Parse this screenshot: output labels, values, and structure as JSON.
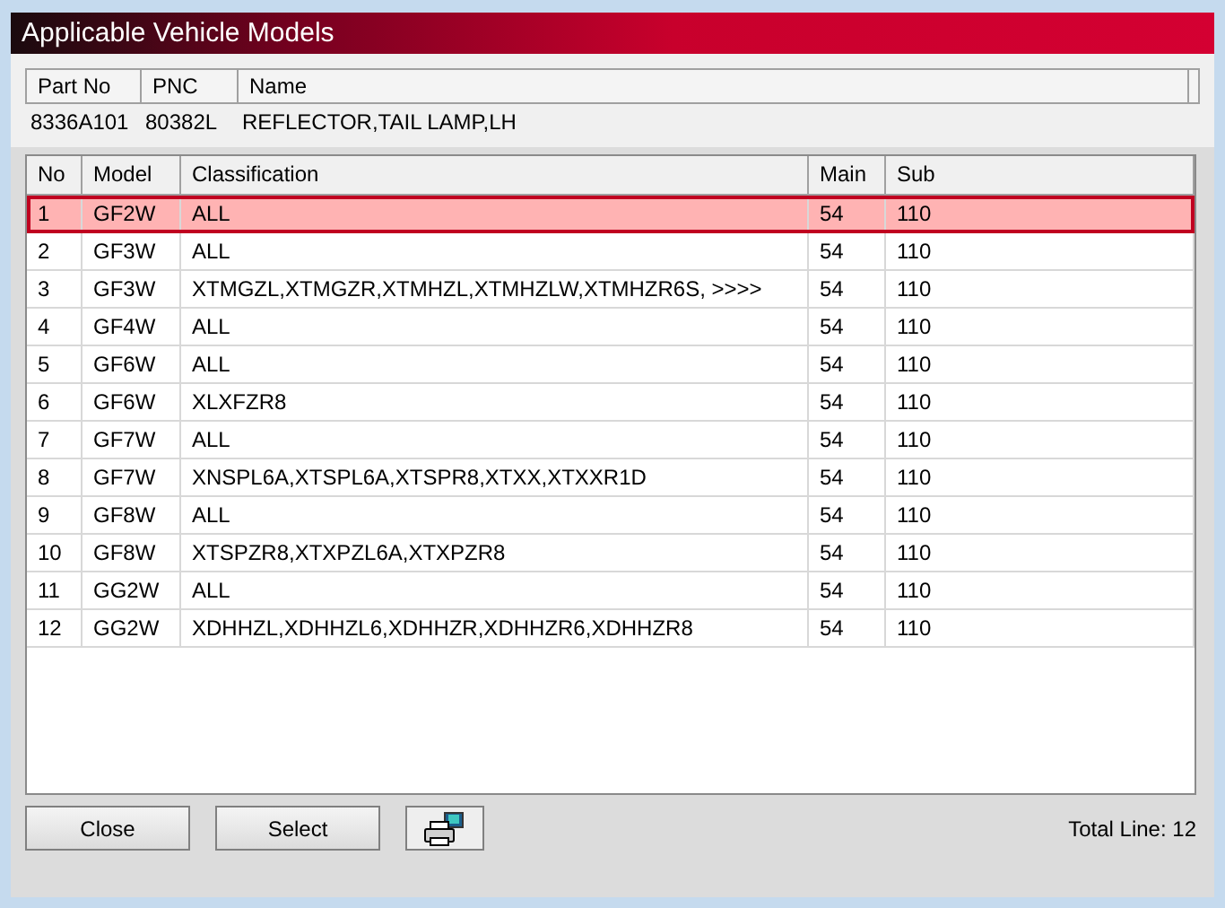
{
  "window": {
    "title": "Applicable Vehicle Models"
  },
  "part": {
    "columns": [
      "Part No",
      "PNC",
      "Name"
    ],
    "values": [
      "8336A101",
      "80382L",
      "REFLECTOR,TAIL LAMP,LH"
    ]
  },
  "table": {
    "columns": [
      "No",
      "Model",
      "Classification",
      "Main",
      "Sub"
    ],
    "rows": [
      {
        "cells": [
          "1",
          "GF2W",
          "ALL",
          "54",
          "110"
        ],
        "selected": true
      },
      {
        "cells": [
          "2",
          "GF3W",
          "ALL",
          "54",
          "110"
        ],
        "selected": false
      },
      {
        "cells": [
          "3",
          "GF3W",
          "XTMGZL,XTMGZR,XTMHZL,XTMHZLW,XTMHZR6S,   >>>>",
          "54",
          "110"
        ],
        "selected": false
      },
      {
        "cells": [
          "4",
          "GF4W",
          "ALL",
          "54",
          "110"
        ],
        "selected": false
      },
      {
        "cells": [
          "5",
          "GF6W",
          "ALL",
          "54",
          "110"
        ],
        "selected": false
      },
      {
        "cells": [
          "6",
          "GF6W",
          "XLXFZR8",
          "54",
          "110"
        ],
        "selected": false
      },
      {
        "cells": [
          "7",
          "GF7W",
          "ALL",
          "54",
          "110"
        ],
        "selected": false
      },
      {
        "cells": [
          "8",
          "GF7W",
          "XNSPL6A,XTSPL6A,XTSPR8,XTXX,XTXXR1D",
          "54",
          "110"
        ],
        "selected": false
      },
      {
        "cells": [
          "9",
          "GF8W",
          "ALL",
          "54",
          "110"
        ],
        "selected": false
      },
      {
        "cells": [
          "10",
          "GF8W",
          "XTSPZR8,XTXPZL6A,XTXPZR8",
          "54",
          "110"
        ],
        "selected": false
      },
      {
        "cells": [
          "11",
          "GG2W",
          "ALL",
          "54",
          "110"
        ],
        "selected": false
      },
      {
        "cells": [
          "12",
          "GG2W",
          "XDHHZL,XDHHZL6,XDHHZR,XDHHZR6,XDHHZR8",
          "54",
          "110"
        ],
        "selected": false
      }
    ]
  },
  "buttons": [
    "Close",
    "Select"
  ],
  "status": "Total Line: 12"
}
